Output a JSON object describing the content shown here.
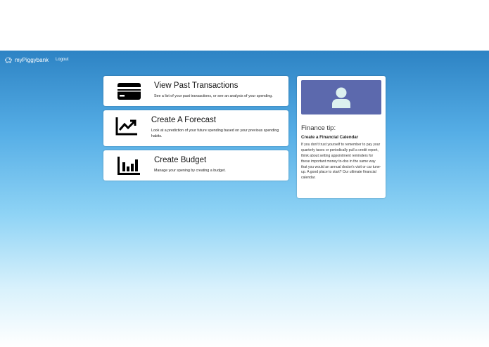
{
  "navbar": {
    "brand": "myPiggybank",
    "brand_icon": "piggy-bank-icon",
    "logout": "Logout"
  },
  "actions": [
    {
      "title": "View Past Transactions",
      "description": "See a list of your past transactions, or see an analysis of your spending.",
      "icon": "credit-card-icon"
    },
    {
      "title": "Create A Forecast",
      "description": "Look at a prediction of your future spending based on your previous spending habits.",
      "icon": "trend-chart-icon"
    },
    {
      "title": "Create Budget",
      "description": "Manage your spening by creating a budget.",
      "icon": "bar-chart-icon"
    }
  ],
  "tip": {
    "image_icon": "user-icon",
    "heading": "Finance tip:",
    "title": "Create a Financial Calendar",
    "body": "If you don't trust yourself to remember to pay your quarterly taxes or periodically pull a credit report, think about setting appointment reminders for these important money to-dos in the same way that you would an annual doctor's visit or car tune-up. A good place to start? Our ultimate financial calendar."
  },
  "colors": {
    "header_blue": "#2d83c4",
    "tip_image_bg": "#5c69ad",
    "tip_icon": "#dcf1ef"
  }
}
